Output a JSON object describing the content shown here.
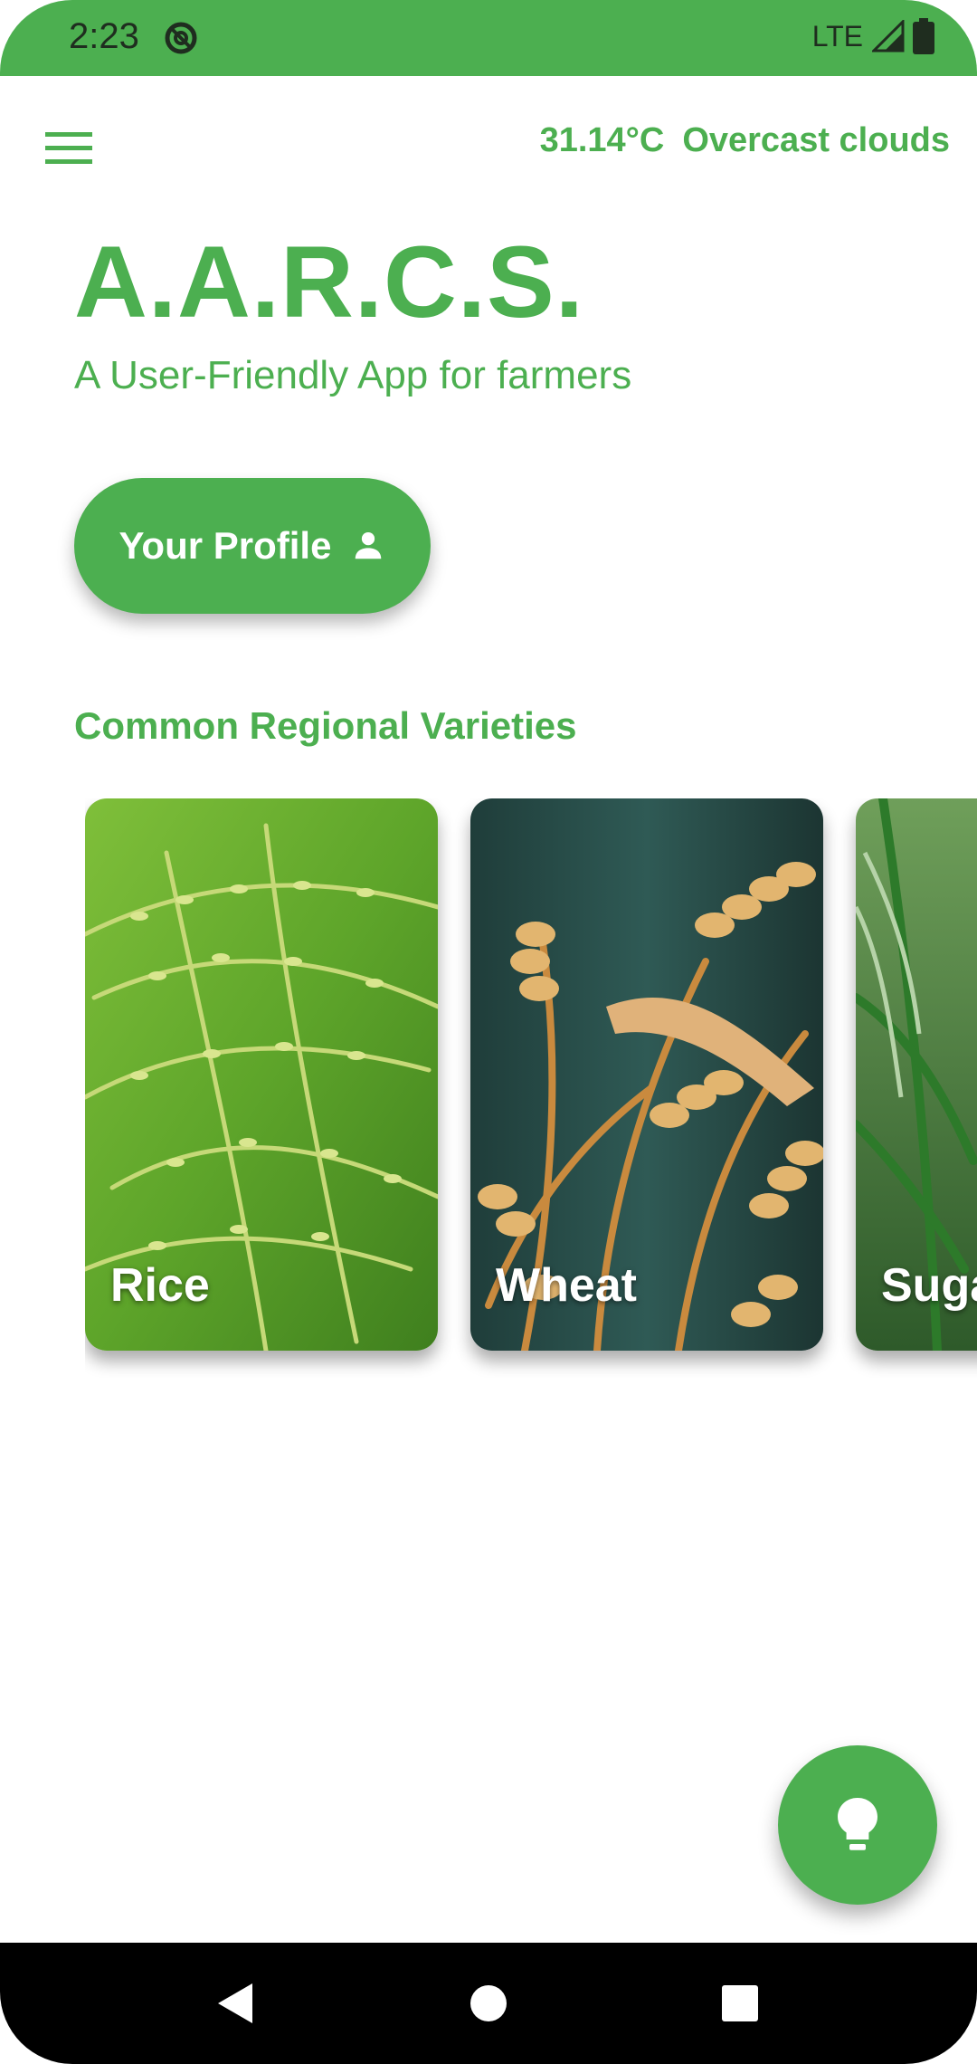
{
  "status_bar": {
    "time": "2:23",
    "network": "LTE",
    "icons": [
      "do-not-disturb-icon",
      "signal-icon",
      "battery-icon"
    ]
  },
  "top_bar": {
    "menu_icon": "menu-icon",
    "temperature": "31.14°C",
    "condition": "Overcast clouds"
  },
  "header": {
    "title": "A.A.R.C.S.",
    "subtitle": "A User-Friendly App for farmers"
  },
  "profile_button": {
    "label": "Your Profile",
    "icon": "person-icon"
  },
  "varieties": {
    "heading": "Common Regional Varieties",
    "items": [
      {
        "label": "Rice"
      },
      {
        "label": "Wheat"
      },
      {
        "label": "Sugarcane"
      }
    ]
  },
  "fab": {
    "icon": "lightbulb-icon"
  },
  "nav_bar": {
    "icons": [
      "back-icon",
      "home-icon",
      "recents-icon"
    ]
  },
  "colors": {
    "primary": "#4caf50",
    "nav_background": "#000000",
    "card_label": "#ffffff"
  }
}
